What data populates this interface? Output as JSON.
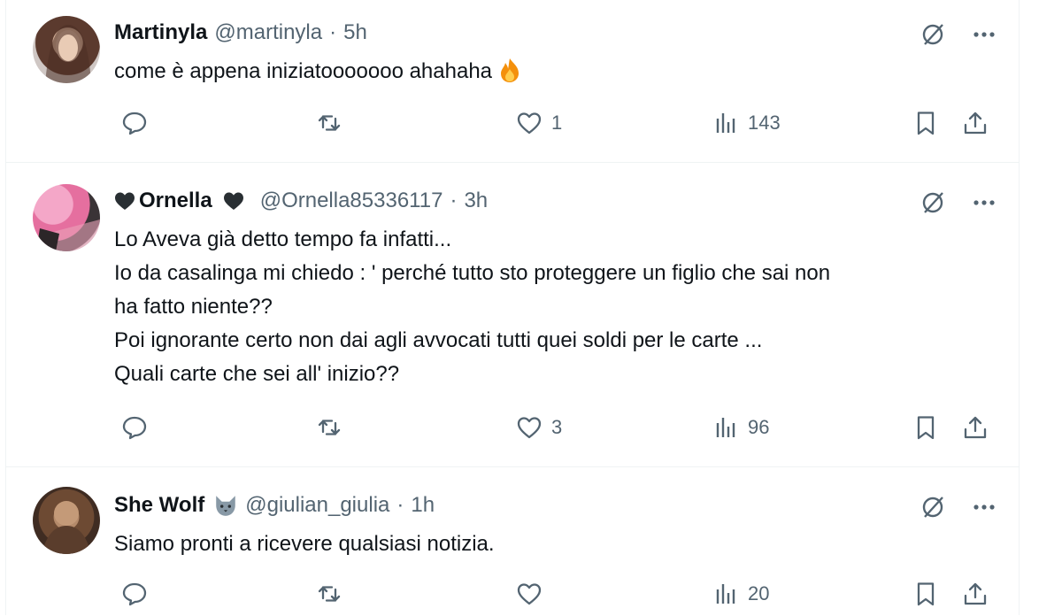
{
  "tweets": [
    {
      "display_name": "Martinyla",
      "handle": "@martinyla",
      "separator": "·",
      "time": "5h",
      "text": "come è appena iniziatooooooo ahahaha",
      "emoji": "fire-icon",
      "replies": "",
      "retweets": "",
      "likes": "1",
      "views": "143"
    },
    {
      "display_name": "Ornella",
      "name_prefix_icon": "black-heart-icon",
      "name_suffix_icon": "black-heart-icon",
      "handle": "@Ornella85336117",
      "separator": "·",
      "time": "3h",
      "text": "Lo Aveva già detto tempo fa infatti...\nIo da casalinga mi chiedo : ' perché tutto sto proteggere un figlio che sai non\nha fatto niente??\nPoi ignorante certo non dai agli avvocati tutti quei soldi per le carte ...\nQuali carte che sei all' inizio??",
      "replies": "",
      "retweets": "",
      "likes": "3",
      "views": "96"
    },
    {
      "display_name": "She Wolf",
      "name_suffix_icon": "wolf-emoji-icon",
      "handle": "@giulian_giulia",
      "separator": "·",
      "time": "1h",
      "text": "Siamo pronti a ricevere qualsiasi notizia.",
      "replies": "",
      "retweets": "",
      "likes": "",
      "views": "20"
    }
  ],
  "colors": {
    "text_primary": "#0f1419",
    "text_secondary": "#536471",
    "divider": "#eff3f4"
  }
}
